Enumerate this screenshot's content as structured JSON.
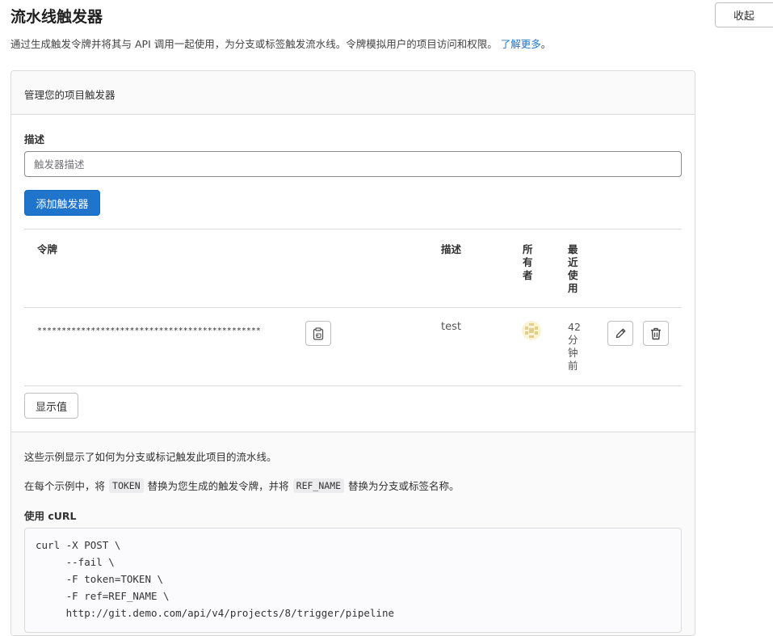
{
  "page": {
    "title": "流水线触发器",
    "collapse_label": "收起",
    "intro_text": "通过生成触发令牌并将其与 API 调用一起使用，为分支或标签触发流水线。令牌模拟用户的项目访问和权限。",
    "learn_more": "了解更多",
    "learn_more_suffix": "。"
  },
  "card": {
    "header": "管理您的项目触发器",
    "form": {
      "description_label": "描述",
      "description_placeholder": "触发器描述",
      "add_button": "添加触发器"
    },
    "table": {
      "columns": [
        "令牌",
        "描述",
        "所有者",
        "最近使用"
      ],
      "rows": [
        {
          "token": "**********************************************",
          "description": "test",
          "last_used": "42分钟前"
        }
      ]
    },
    "reveal_button": "显示值"
  },
  "examples": {
    "line1": "这些示例显示了如何为分支或标记触发此项目的流水线。",
    "line2_prefix": "在每个示例中，将",
    "token_chip": "TOKEN",
    "line2_middle": "替换为您生成的触发令牌，并将",
    "ref_chip": "REF_NAME",
    "line2_suffix": "替换为分支或标签名称。",
    "curl_label": "使用 cURL",
    "curl_code": "curl -X POST \\\n     --fail \\\n     -F token=TOKEN \\\n     -F ref=REF_NAME \\\n     http://git.demo.com/api/v4/projects/8/trigger/pipeline"
  },
  "colors": {
    "primary": "#1f75cb",
    "border": "#dbdbdb",
    "avatar_bg": "#fbf3d5",
    "avatar_fg": "#d8c37a"
  }
}
